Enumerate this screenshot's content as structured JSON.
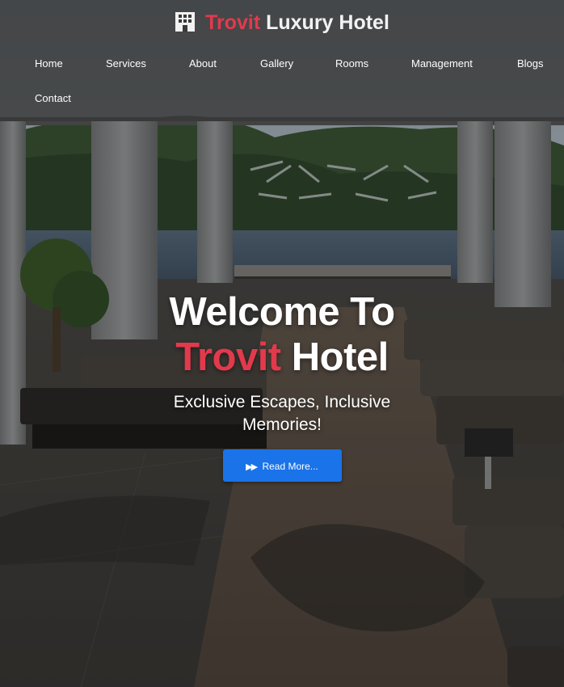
{
  "brand": {
    "accent_word": "Trovit",
    "rest": "Luxury Hotel",
    "icon": "hotel-building-icon"
  },
  "nav": {
    "items": [
      {
        "label": "Home"
      },
      {
        "label": "Services"
      },
      {
        "label": "About"
      },
      {
        "label": "Gallery"
      },
      {
        "label": "Rooms"
      },
      {
        "label": "Management"
      },
      {
        "label": "Blogs"
      },
      {
        "label": "Contact"
      }
    ]
  },
  "hero": {
    "title_line1": "Welcome To",
    "title_accent": "Trovit",
    "title_rest": "Hotel",
    "subtitle": "Exclusive Escapes, Inclusive Memories!",
    "cta_label": "Read More...",
    "cta_icon": "fast-forward-icon"
  },
  "colors": {
    "accent": "#e3394d",
    "button": "#1a73e8",
    "header_bg": "#373737"
  }
}
